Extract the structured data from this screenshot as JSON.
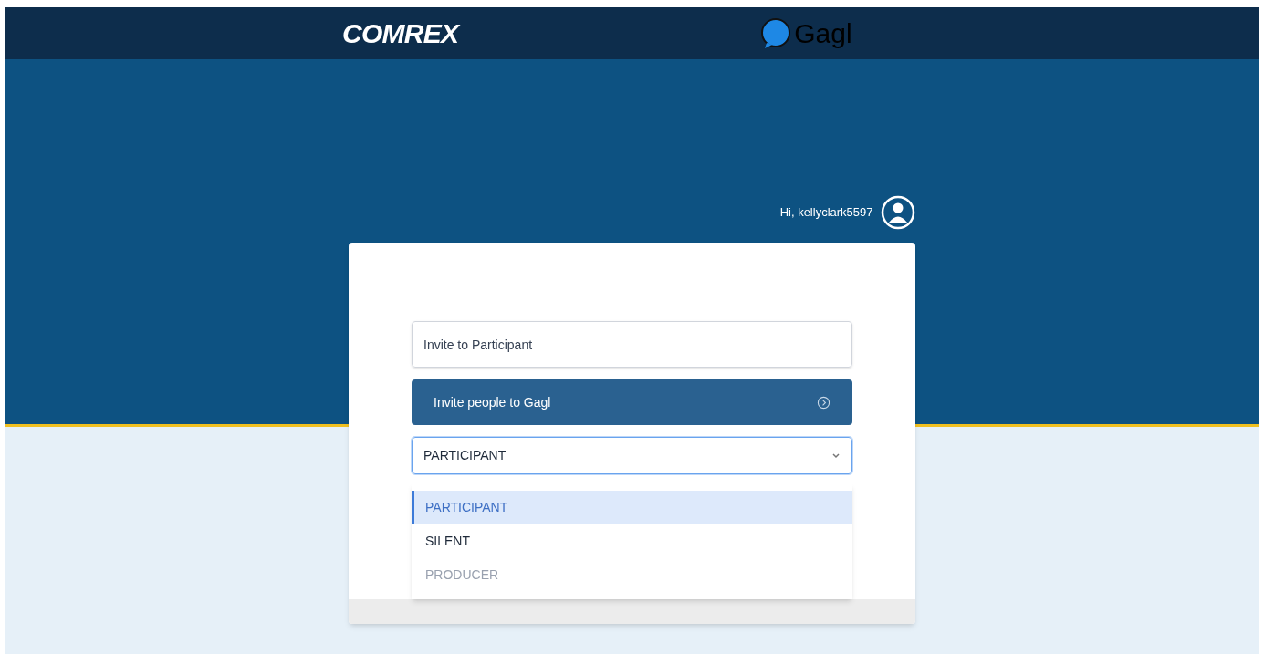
{
  "header": {
    "logo_left": "COMREX",
    "logo_right": "Gagl"
  },
  "user": {
    "greeting": "Hi, kellyclark5597"
  },
  "form": {
    "invite_field": {
      "value": "Invite to Participant"
    },
    "invite_button": "Invite people to Gagl",
    "role_select": {
      "value": "PARTICIPANT",
      "expanded": true
    },
    "options": [
      {
        "label": "PARTICIPANT",
        "selected": true,
        "disabled": false
      },
      {
        "label": "SILENT",
        "selected": false,
        "disabled": false
      },
      {
        "label": "PRODUCER",
        "selected": false,
        "disabled": true
      }
    ]
  }
}
